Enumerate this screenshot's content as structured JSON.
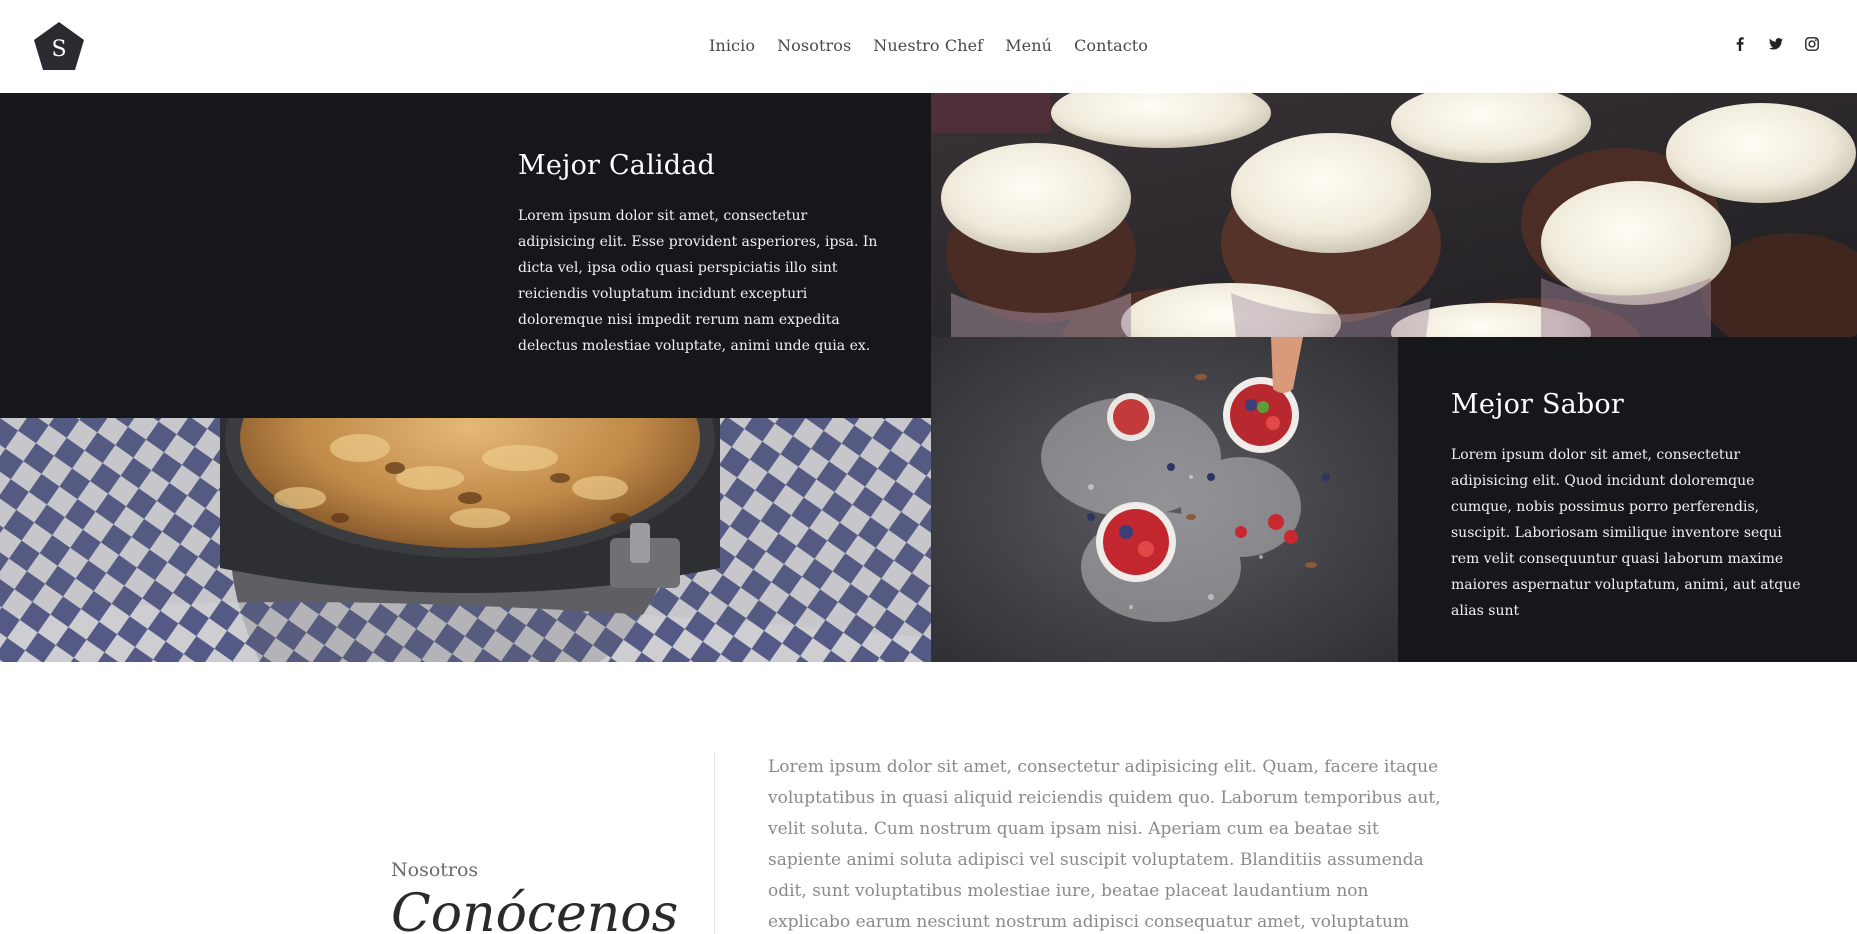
{
  "brand": {
    "logo_letter": "S"
  },
  "nav": {
    "items": [
      "Inicio",
      "Nosotros",
      "Nuestro Chef",
      "Menú",
      "Contacto"
    ]
  },
  "social": [
    {
      "icon": "facebook-icon"
    },
    {
      "icon": "twitter-icon"
    },
    {
      "icon": "instagram-icon"
    }
  ],
  "features": [
    {
      "title": "Mejor Calidad",
      "text": "Lorem ipsum dolor sit amet, consectetur adipisicing elit. Esse provident asperiores, ipsa. In dicta vel, ipsa odio quasi perspiciatis illo sint reiciendis voluptatum incidunt excepturi doloremque nisi impedit rerum nam expedita delectus molestiae voluptate, animi unde quia ex."
    },
    {
      "title": "Mejor Sabor",
      "text": "Lorem ipsum dolor sit amet, consectetur adipisicing elit. Quod incidunt doloremque cumque, nobis possimus porro perferendis, suscipit. Laboriosam similique inventore sequi rem velit consequuntur quasi laborum maxime maiores aspernatur voluptatum, animi, aut atque alias sunt"
    }
  ],
  "about": {
    "eyebrow": "Nosotros",
    "title": "Conócenos",
    "body": "Lorem ipsum dolor sit amet, consectetur adipisicing elit. Quam, facere itaque voluptatibus in quasi aliquid reiciendis quidem quo. Laborum temporibus aut, velit soluta. Cum nostrum quam ipsam nisi. Aperiam cum ea beatae sit sapiente animi soluta adipisci vel suscipit voluptatem. Blanditiis assumenda odit, sunt voluptatibus molestiae iure, beatae placeat laudantium non explicabo earum nesciunt nostrum adipisci consequatur amet, voluptatum laborum aspernatur autem architecto quae"
  },
  "colors": {
    "dark_block": "#16171b",
    "nav_text": "#4a4a4a",
    "body_muted": "#8a8a8a"
  }
}
